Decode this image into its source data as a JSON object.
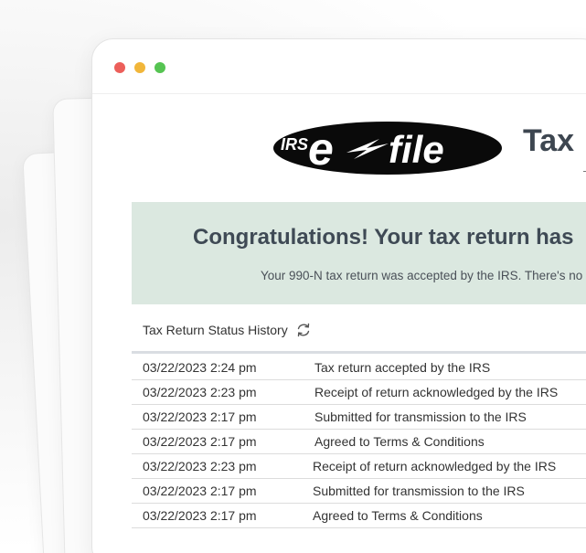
{
  "window": {
    "traffic_lights": [
      "close",
      "minimize",
      "maximize"
    ]
  },
  "logo": {
    "prefix": "IRS",
    "main": "e",
    "suffix": "file"
  },
  "header": {
    "title": "Tax"
  },
  "banner": {
    "heading": "Congratulations! Your tax return has",
    "subtext": "Your 990-N tax return was accepted by the IRS. There's no"
  },
  "status": {
    "heading": "Tax Return Status History",
    "refresh_icon": "refresh-icon"
  },
  "history": [
    {
      "date": "03/22/2023 2:24 pm",
      "event": "Tax return accepted by the IRS"
    },
    {
      "date": "03/22/2023 2:23 pm",
      "event": "Receipt of return acknowledged by the IRS"
    },
    {
      "date": "03/22/2023 2:17 pm",
      "event": "Submitted for transmission to the IRS"
    },
    {
      "date": "03/22/2023 2:17 pm",
      "event": "Agreed to Terms & Conditions"
    },
    {
      "date": "03/22/2023 2:23 pm",
      "event": "Receipt of return acknowledged by the IRS"
    },
    {
      "date": "03/22/2023 2:17 pm",
      "event": "Submitted for transmission to the IRS"
    },
    {
      "date": "03/22/2023 2:17 pm",
      "event": "Agreed to Terms & Conditions"
    }
  ],
  "colors": {
    "banner_bg": "#dbe8e0",
    "close": "#ec5f5a",
    "minimize": "#f1b63a",
    "maximize": "#56c452"
  }
}
